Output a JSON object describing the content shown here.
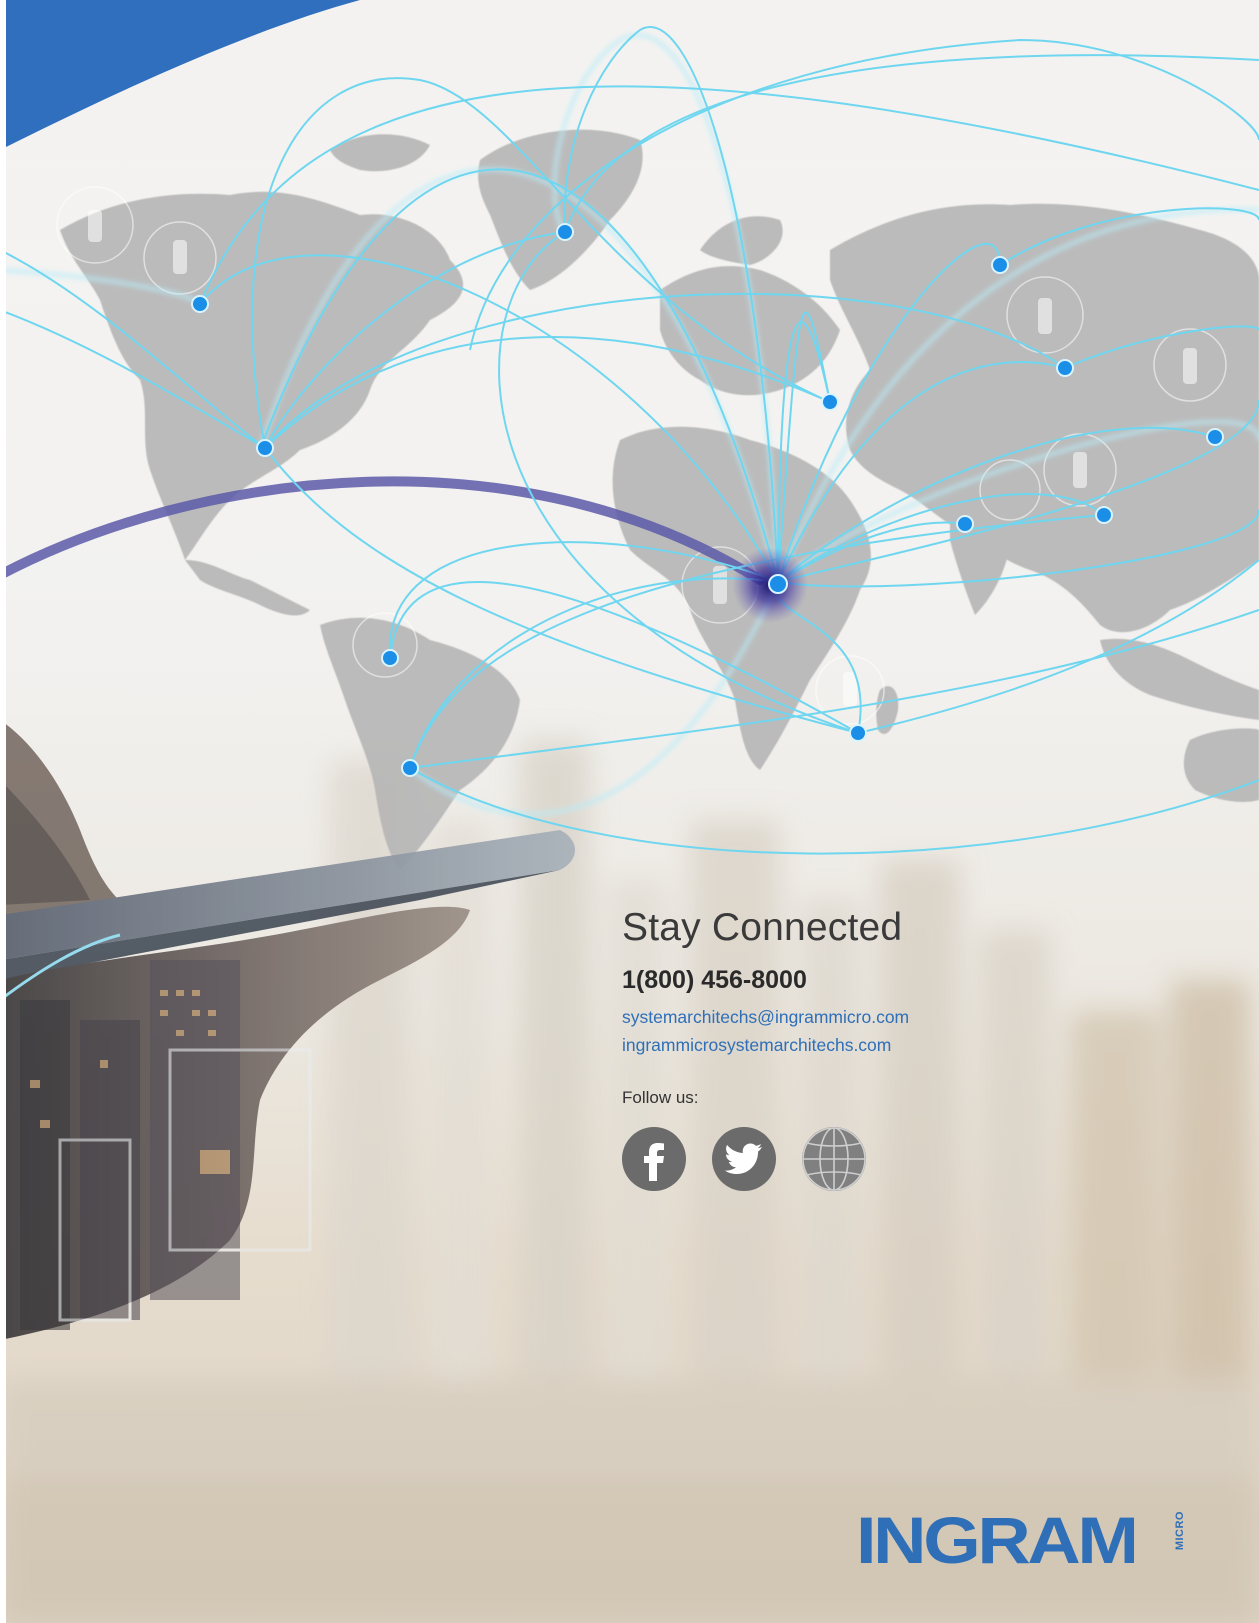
{
  "contact": {
    "title": "Stay Connected",
    "phone": "1(800) 456-8000",
    "email": "systemarchitechs@ingrammicro.com",
    "website": "ingrammicrosystemarchitechs.com",
    "follow_label": "Follow us:"
  },
  "social": [
    {
      "name": "facebook",
      "icon": "facebook-icon"
    },
    {
      "name": "twitter",
      "icon": "twitter-icon"
    },
    {
      "name": "website",
      "icon": "globe-icon"
    }
  ],
  "brand": {
    "logo_text": "INGRAM",
    "logo_sub": "MICRO",
    "color": "#2e6fb8"
  },
  "colors": {
    "accent_blue": "#2e6fb8",
    "network_line": "#5fd3ee",
    "node": "#1b8fe8",
    "map_land": "#b9b9b9",
    "icon_gray": "#6b6b6b"
  }
}
